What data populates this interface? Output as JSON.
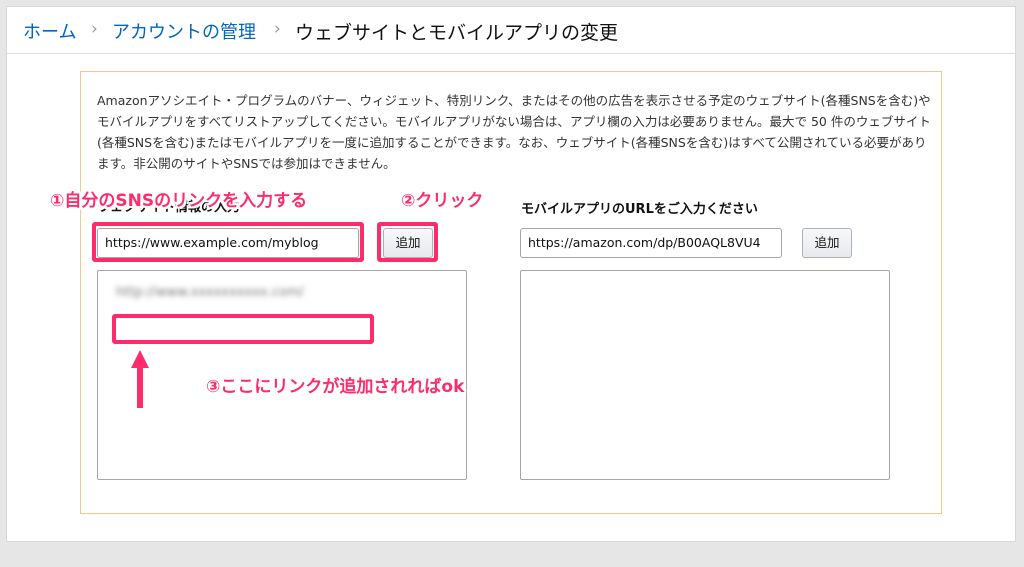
{
  "breadcrumb": {
    "home": "ホーム",
    "account": "アカウントの管理",
    "current": "ウェブサイトとモバイルアプリの変更",
    "separator": "›"
  },
  "description": "Amazonアソシエイト・プログラムのバナー、ウィジェット、特別リンク、またはその他の広告を表示させる予定のウェブサイト(各種SNSを含む)やモバイルアプリをすべてリストアップしてください。モバイルアプリがない場合は、アプリ欄の入力は必要ありません。最大で 50 件のウェブサイト(各種SNSを含む)またはモバイルアプリを一度に追加することができます。なお、ウェブサイト(各種SNSを含む)はすべて公開されている必要があります。非公開のサイトやSNSでは参加はできません。",
  "website": {
    "label": "ウェブサイト情報の入力",
    "required_mark": "*",
    "input_value": "https://www.example.com/myblog",
    "add_label": "追加",
    "blurred_entry": "http://www.xxxxxxxxxx.com/"
  },
  "mobile": {
    "label": "モバイルアプリのURLをご入力ください",
    "input_value": "https://amazon.com/dp/B00AQL8VU4",
    "add_label": "追加"
  },
  "annotations": {
    "step1": "①自分のSNSのリンクを入力する",
    "step2": "②クリック",
    "step3": "③ここにリンクが追加されればok"
  },
  "colors": {
    "highlight": "#ff2c6c",
    "link": "#0066c0",
    "panel_border": "#f0c98b"
  }
}
